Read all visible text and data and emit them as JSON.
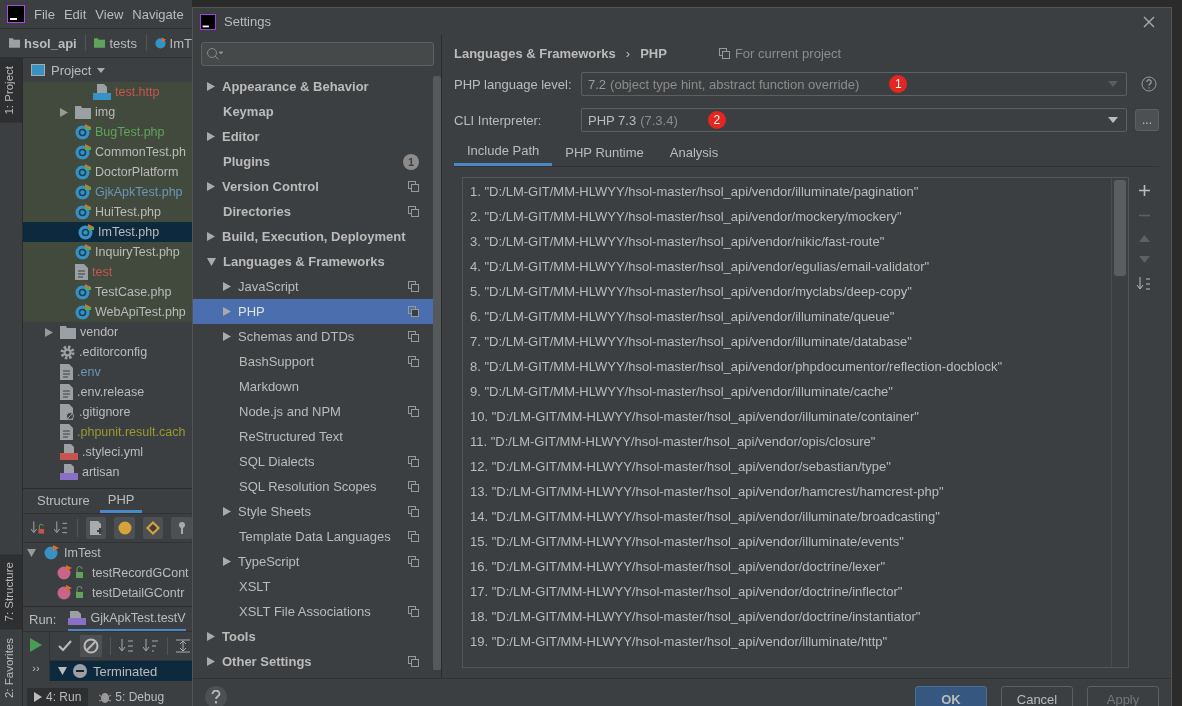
{
  "ide": {
    "menu": [
      {
        "label": "File"
      },
      {
        "label": "Edit"
      },
      {
        "label": "View"
      },
      {
        "label": "Navigate"
      }
    ],
    "breadcrumb": [
      {
        "label": "hsol_api",
        "kind": "module"
      },
      {
        "label": "tests",
        "kind": "folder"
      },
      {
        "label": "ImT",
        "kind": "class"
      }
    ],
    "side_tabs_top": [
      {
        "label": "1: Project",
        "selected": true
      }
    ],
    "side_tabs_bottom": [
      {
        "label": "7: Structure",
        "selected": true
      },
      {
        "label": "2: Favorites",
        "selected": false
      }
    ],
    "project": {
      "title": "Project",
      "tree": [
        {
          "children": [
            {
              "children": [
                {
                  "label": "test.http",
                  "kind": "api",
                  "color": "#c75450",
                  "selected": false
                }
              ]
            },
            {
              "label": "img",
              "kind": "folder",
              "expanded": false,
              "color": "#bbbbbb",
              "selected": false
            },
            {
              "label": "BugTest.php",
              "kind": "class",
              "color": "#62a35c",
              "selected": false
            },
            {
              "label": "CommonTest.ph",
              "kind": "class",
              "color": "#bbbbbb",
              "selected": false
            },
            {
              "label": "DoctorPlatform",
              "kind": "class",
              "color": "#bbbbbb",
              "selected": false
            },
            {
              "label": "GjkApkTest.php",
              "kind": "class",
              "color": "#6897bb",
              "selected": false
            },
            {
              "label": "HuiTest.php",
              "kind": "class",
              "color": "#bbbbbb",
              "selected": false
            },
            {
              "label": "ImTest.php",
              "kind": "class",
              "color": "#bbbbbb",
              "selected": true
            },
            {
              "label": "InquiryTest.php",
              "kind": "class",
              "color": "#bbbbbb",
              "selected": false
            },
            {
              "label": "test",
              "kind": "text",
              "color": "#c75450",
              "selected": false
            },
            {
              "label": "TestCase.php",
              "kind": "class",
              "color": "#bbbbbb",
              "selected": false
            },
            {
              "label": "WebApiTest.php",
              "kind": "class",
              "color": "#bbbbbb",
              "selected": false
            }
          ]
        },
        {
          "label": "vendor",
          "kind": "folder",
          "expanded": false,
          "color": "#bbbbbb",
          "selected": false
        },
        {
          "label": ".editorconfig",
          "kind": "config",
          "color": "#bbbbbb",
          "selected": false
        },
        {
          "label": ".env",
          "kind": "text",
          "color": "#6897bb",
          "selected": false
        },
        {
          "label": ".env.release",
          "kind": "text",
          "color": "#bbbbbb",
          "selected": false
        },
        {
          "label": ".gitignore",
          "kind": "ignore",
          "color": "#bbbbbb",
          "selected": false
        },
        {
          "label": ".phpunit.result.cach",
          "kind": "text",
          "color": "#9a9a2e",
          "selected": false
        },
        {
          "label": ".styleci.yml",
          "kind": "yml",
          "color": "#bbbbbb",
          "selected": false
        },
        {
          "label": "artisan",
          "kind": "php",
          "color": "#bbbbbb",
          "selected": false
        }
      ]
    },
    "structure": {
      "tabs": [
        {
          "label": "Structure",
          "selected": false
        },
        {
          "label": "PHP",
          "selected": true
        }
      ],
      "tree": [
        {
          "label": "ImTest",
          "expanded": true,
          "children": [
            {
              "label": "testRecordGCont"
            },
            {
              "label": "testDetailGContr"
            }
          ]
        }
      ]
    },
    "run": {
      "label": "Run:",
      "tab": "GjkApkTest.testV",
      "more": "››",
      "tree": [
        {
          "label": "Terminated",
          "expanded": true
        }
      ]
    },
    "bottom_tabs": [
      {
        "label": "4: Run",
        "selected": true
      },
      {
        "label": "5: Debug",
        "selected": false
      }
    ]
  },
  "settings": {
    "title": "Settings",
    "sidebar": [
      {
        "label": "Appearance & Behavior",
        "expanded": false,
        "shared": false,
        "selected": false
      },
      {
        "label": "Keymap",
        "shared": false,
        "selected": false
      },
      {
        "label": "Editor",
        "expanded": false,
        "shared": false,
        "selected": false
      },
      {
        "label": "Plugins",
        "shared": false,
        "badge": "1",
        "selected": false
      },
      {
        "label": "Version Control",
        "expanded": false,
        "shared": true,
        "selected": false
      },
      {
        "label": "Directories",
        "shared": true,
        "selected": false
      },
      {
        "label": "Build, Execution, Deployment",
        "expanded": false,
        "shared": false,
        "selected": false
      },
      {
        "label": "Languages & Frameworks",
        "expanded": true,
        "shared": false,
        "selected": false,
        "children": [
          {
            "label": "JavaScript",
            "expanded": false,
            "shared": true,
            "selected": false
          },
          {
            "label": "PHP",
            "expanded": false,
            "shared": true,
            "selected": true
          },
          {
            "label": "Schemas and DTDs",
            "expanded": false,
            "shared": true,
            "selected": false
          },
          {
            "label": "BashSupport",
            "shared": true,
            "selected": false
          },
          {
            "label": "Markdown",
            "shared": false,
            "selected": false
          },
          {
            "label": "Node.js and NPM",
            "shared": true,
            "selected": false
          },
          {
            "label": "ReStructured Text",
            "shared": false,
            "selected": false
          },
          {
            "label": "SQL Dialects",
            "shared": true,
            "selected": false
          },
          {
            "label": "SQL Resolution Scopes",
            "shared": true,
            "selected": false
          },
          {
            "label": "Style Sheets",
            "expanded": false,
            "shared": true,
            "selected": false
          },
          {
            "label": "Template Data Languages",
            "shared": true,
            "selected": false
          },
          {
            "label": "TypeScript",
            "expanded": false,
            "shared": true,
            "selected": false
          },
          {
            "label": "XSLT",
            "shared": false,
            "selected": false
          },
          {
            "label": "XSLT File Associations",
            "shared": true,
            "selected": false
          }
        ]
      },
      {
        "label": "Tools",
        "expanded": false,
        "shared": false,
        "selected": false
      },
      {
        "label": "Other Settings",
        "expanded": false,
        "shared": true,
        "selected": false
      }
    ],
    "breadcrumb": [
      "Languages & Frameworks",
      "PHP"
    ],
    "separator": "›",
    "scope_note": "For current project",
    "fields": [
      {
        "kind": "level",
        "label": "PHP language level:",
        "value": "7.2",
        "hint": "(object type hint, abstract function override)",
        "marker": "1"
      },
      {
        "kind": "interpreter",
        "label": "CLI Interpreter:",
        "value": "PHP 7.3",
        "hint": "(7.3.4)",
        "marker": "2",
        "browse": "..."
      }
    ],
    "tabs": [
      {
        "label": "Include Path",
        "selected": true
      },
      {
        "label": "PHP Runtime",
        "selected": false
      },
      {
        "label": "Analysis",
        "selected": false
      }
    ],
    "paths": [
      "1. \"D:/LM-GIT/MM-HLWYY/hsol-master/hsol_api/vendor/illuminate/pagination\"",
      "2. \"D:/LM-GIT/MM-HLWYY/hsol-master/hsol_api/vendor/mockery/mockery\"",
      "3. \"D:/LM-GIT/MM-HLWYY/hsol-master/hsol_api/vendor/nikic/fast-route\"",
      "4. \"D:/LM-GIT/MM-HLWYY/hsol-master/hsol_api/vendor/egulias/email-validator\"",
      "5. \"D:/LM-GIT/MM-HLWYY/hsol-master/hsol_api/vendor/myclabs/deep-copy\"",
      "6. \"D:/LM-GIT/MM-HLWYY/hsol-master/hsol_api/vendor/illuminate/queue\"",
      "7. \"D:/LM-GIT/MM-HLWYY/hsol-master/hsol_api/vendor/illuminate/database\"",
      "8. \"D:/LM-GIT/MM-HLWYY/hsol-master/hsol_api/vendor/phpdocumentor/reflection-docblock\"",
      "9. \"D:/LM-GIT/MM-HLWYY/hsol-master/hsol_api/vendor/illuminate/cache\"",
      "10. \"D:/LM-GIT/MM-HLWYY/hsol-master/hsol_api/vendor/illuminate/container\"",
      "11. \"D:/LM-GIT/MM-HLWYY/hsol-master/hsol_api/vendor/opis/closure\"",
      "12. \"D:/LM-GIT/MM-HLWYY/hsol-master/hsol_api/vendor/sebastian/type\"",
      "13. \"D:/LM-GIT/MM-HLWYY/hsol-master/hsol_api/vendor/hamcrest/hamcrest-php\"",
      "14. \"D:/LM-GIT/MM-HLWYY/hsol-master/hsol_api/vendor/illuminate/broadcasting\"",
      "15. \"D:/LM-GIT/MM-HLWYY/hsol-master/hsol_api/vendor/illuminate/events\"",
      "16. \"D:/LM-GIT/MM-HLWYY/hsol-master/hsol_api/vendor/doctrine/lexer\"",
      "17. \"D:/LM-GIT/MM-HLWYY/hsol-master/hsol_api/vendor/doctrine/inflector\"",
      "18. \"D:/LM-GIT/MM-HLWYY/hsol-master/hsol_api/vendor/doctrine/instantiator\"",
      "19. \"D:/LM-GIT/MM-HLWYY/hsol-master/hsol_api/vendor/illuminate/http\""
    ],
    "list_tools": [
      {
        "kind": "add",
        "disabled": false
      },
      {
        "kind": "remove",
        "disabled": true
      },
      {
        "kind": "up",
        "disabled": true
      },
      {
        "kind": "down",
        "disabled": true
      },
      {
        "kind": "sort",
        "disabled": false
      }
    ],
    "buttons": [
      {
        "label": "OK",
        "kind": "primary",
        "disabled": false
      },
      {
        "label": "Cancel",
        "kind": "normal",
        "disabled": false
      },
      {
        "label": "Apply",
        "kind": "normal",
        "disabled": true
      }
    ]
  }
}
